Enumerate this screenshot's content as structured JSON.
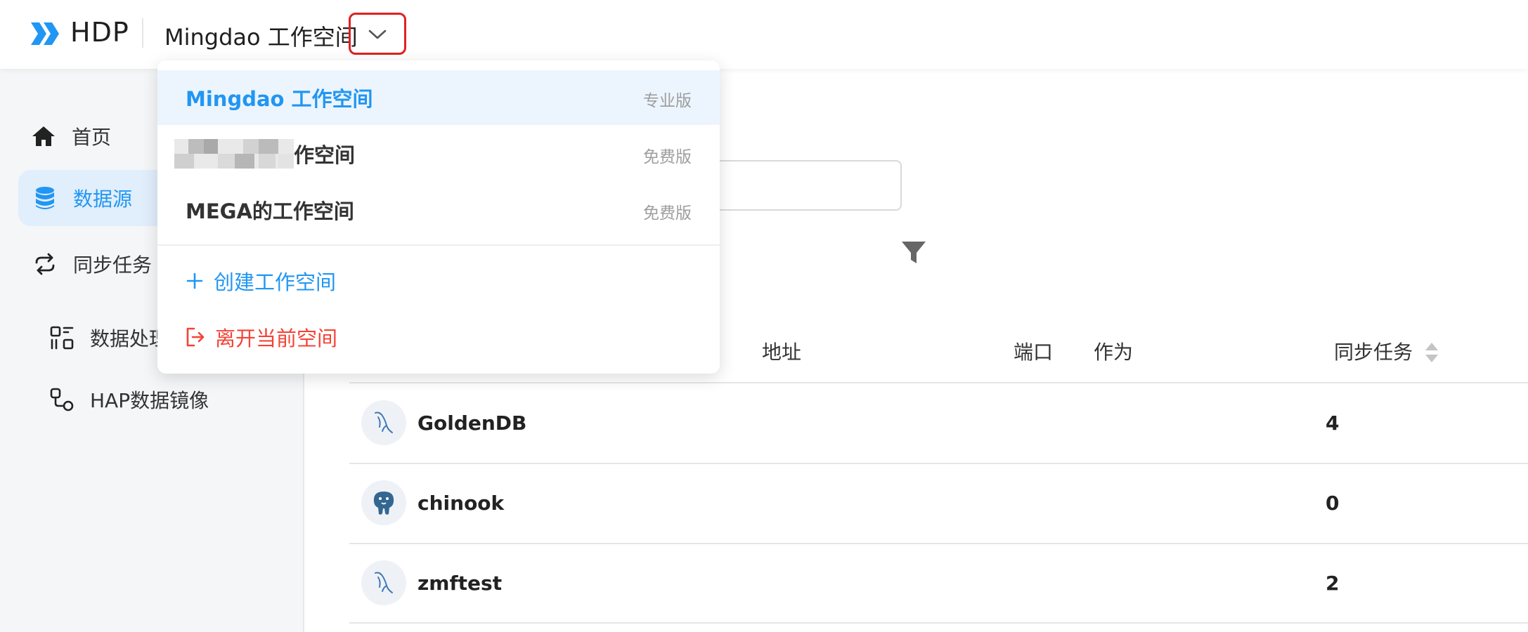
{
  "header": {
    "logo_text": "HDP",
    "workspace_name": "Mingdao 工作空间"
  },
  "sidebar": {
    "items": [
      {
        "label": "首页",
        "icon": "home-icon"
      },
      {
        "label": "数据源",
        "icon": "database-icon",
        "active": true
      },
      {
        "label": "同步任务",
        "icon": "sync-icon"
      },
      {
        "label": "数据处理",
        "icon": "data-process-icon"
      },
      {
        "label": "HAP数据镜像",
        "icon": "mirror-icon"
      }
    ]
  },
  "main": {
    "search": {
      "value": "",
      "placeholder": ""
    },
    "columns": {
      "address": "地址",
      "port": "端口",
      "as": "作为",
      "sync_tasks": "同步任务"
    },
    "rows": [
      {
        "name": "GoldenDB",
        "sync_tasks": "4",
        "icon": "mysql-icon"
      },
      {
        "name": "chinook",
        "sync_tasks": "0",
        "icon": "postgresql-icon"
      },
      {
        "name": "zmftest",
        "sync_tasks": "2",
        "icon": "mysql-icon"
      }
    ]
  },
  "dropdown": {
    "workspaces": [
      {
        "name": "Mingdao 工作空间",
        "plan": "专业版",
        "selected": true
      },
      {
        "name_suffix": "作空间",
        "plan": "免费版",
        "name_blurred": true
      },
      {
        "name": "MEGA的工作空间",
        "plan": "免费版"
      }
    ],
    "create_label": "创建工作空间",
    "leave_label": "离开当前空间"
  },
  "colors": {
    "accent": "#2196f3",
    "danger": "#f44336",
    "highlight_border": "#e02020",
    "selected_bg": "#ecf5fd",
    "sidebar_active_bg": "#e1eefc"
  }
}
